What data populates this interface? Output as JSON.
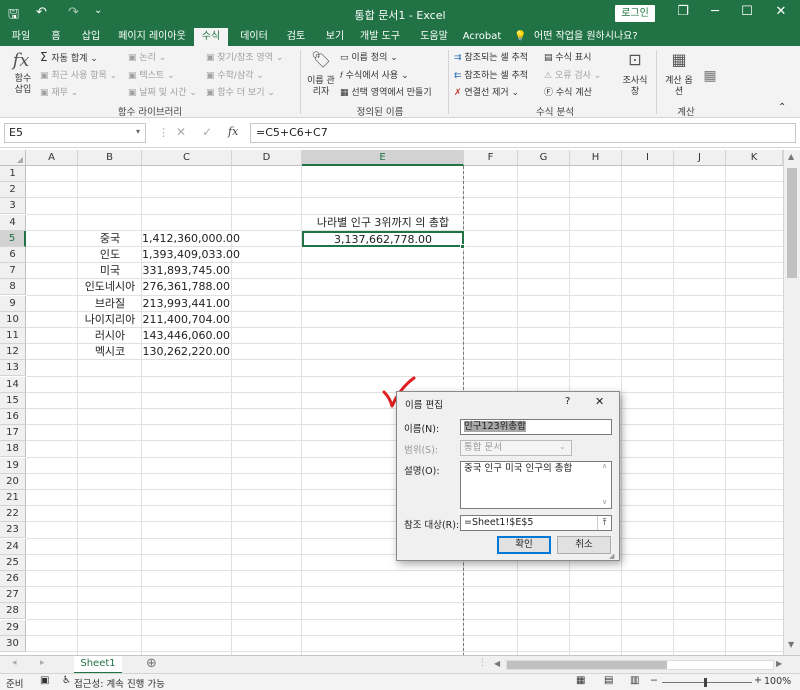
{
  "titlebar": {
    "title": "통합 문서1 - Excel",
    "login": "로그인",
    "qa_save": "🖫",
    "qa_undo": "↶",
    "qa_redo": "↷",
    "qa_more": "⌄",
    "min": "─",
    "restore": "❐",
    "max": "☐",
    "close": "✕"
  },
  "tabs": [
    "파일",
    "홈",
    "삽입",
    "페이지 레이아웃",
    "수식",
    "데이터",
    "검토",
    "보기",
    "개발 도구",
    "도움말",
    "Acrobat",
    "어떤 작업을 원하시나요?"
  ],
  "ribbon": {
    "groups": {
      "library": "함수 라이브러리",
      "names": "정의된 이름",
      "audit": "수식 분석",
      "calc": "계산"
    },
    "insert_function": "함수 삽입",
    "autosum": "자동 합계",
    "recent": "최근 사용 항목",
    "finance": "재무",
    "logic": "논리",
    "text": "텍스트",
    "datetime": "날짜 및 시간",
    "lookup": "찾기/참조 영역",
    "math": "수학/삼각",
    "more_functions": "함수 더 보기",
    "name_manager": "이름 관리자",
    "define_name": "이름 정의",
    "use_in_formula": "수식에서 사용",
    "create_from_selection": "선택 영역에서 만들기",
    "trace_precedents": "참조되는 셀 추적",
    "trace_dependents": "참조하는 셀 추적",
    "remove_arrows": "연결선 제거",
    "show_formulas": "수식 표시",
    "error_checking": "오류 검사",
    "evaluate_formula": "수식 계산",
    "watch_window": "조사식 창",
    "calc_options": "계산 옵션"
  },
  "formula_bar": {
    "name_box": "E5",
    "fx": "fx",
    "formula": "=C5+C6+C7"
  },
  "columns": [
    "A",
    "B",
    "C",
    "D",
    "E",
    "F",
    "G",
    "H",
    "I",
    "J",
    "K"
  ],
  "rows": [
    "1",
    "2",
    "3",
    "4",
    "5",
    "6",
    "7",
    "8",
    "9",
    "10",
    "11",
    "12",
    "13",
    "14",
    "15",
    "16",
    "17",
    "18",
    "19",
    "20",
    "21",
    "22",
    "23",
    "24",
    "25",
    "26",
    "27",
    "28",
    "29",
    "30"
  ],
  "sheet": {
    "e4_title": "나라별 인구 3위까지 의 총합",
    "e5_total": "3,137,662,778.00",
    "countries": [
      {
        "name": "중국",
        "population": "1,412,360,000.00"
      },
      {
        "name": "인도",
        "population": "1,393,409,033.00"
      },
      {
        "name": "미국",
        "population": "331,893,745.00"
      },
      {
        "name": "인도네시아",
        "population": "276,361,788.00"
      },
      {
        "name": "브라질",
        "population": "213,993,441.00"
      },
      {
        "name": "나이지리아",
        "population": "211,400,704.00"
      },
      {
        "name": "러시아",
        "population": "143,446,060.00"
      },
      {
        "name": "멕시코",
        "population": "130,262,220.00"
      }
    ]
  },
  "dialog": {
    "title": "이름 편집",
    "help": "?",
    "close": "✕",
    "name_label": "이름(N):",
    "name_value": "인구123위총합",
    "scope_label": "범위(S):",
    "scope_value": "통합 문서",
    "comment_label": "설명(O):",
    "comment_value": "중국 인구 미국 인구의 총합",
    "refers_label": "참조 대상(R):",
    "refers_value": "=Sheet1!$E$5",
    "ok": "확인",
    "cancel": "취소"
  },
  "sheet_tab": "Sheet1",
  "status": {
    "ready": "준비",
    "accessibility": "접근성: 계속 진행 가능",
    "zoom": "100%"
  },
  "colors": {
    "accent": "#217346",
    "checkmark": "#e02020"
  }
}
